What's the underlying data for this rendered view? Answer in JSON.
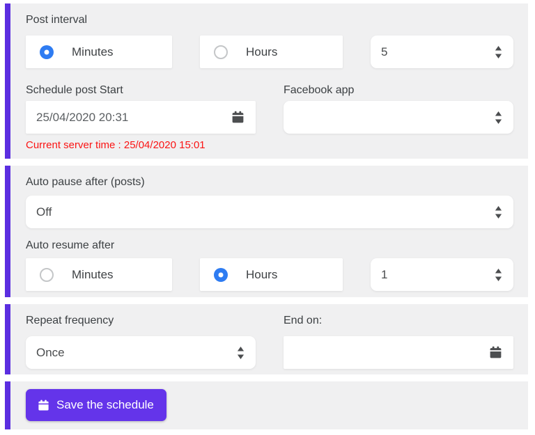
{
  "colors": {
    "accent_purple": "#5b2ee0",
    "button_purple": "#6434ea",
    "radio_selected_blue": "#2e7cf2",
    "section_background": "#f0f0f1",
    "server_time_red": "#fb1414"
  },
  "post_interval": {
    "label": "Post interval",
    "options": [
      {
        "label": "Minutes",
        "selected": true
      },
      {
        "label": "Hours",
        "selected": false
      }
    ],
    "value": "5"
  },
  "schedule_start": {
    "label": "Schedule post Start",
    "value": "25/04/2020 20:31",
    "server_time_note": "Current server time : 25/04/2020 15:01"
  },
  "facebook_app": {
    "label": "Facebook app",
    "value": ""
  },
  "auto_pause": {
    "label": "Auto pause after (posts)",
    "value": "Off"
  },
  "auto_resume": {
    "label": "Auto resume after",
    "options": [
      {
        "label": "Minutes",
        "selected": false
      },
      {
        "label": "Hours",
        "selected": true
      }
    ],
    "value": "1"
  },
  "repeat_frequency": {
    "label": "Repeat frequency",
    "value": "Once"
  },
  "end_on": {
    "label": "End on:",
    "value": ""
  },
  "save_button": {
    "label": "Save the schedule"
  },
  "icons": {
    "spinner": "updown-spinner-icon",
    "calendar": "calendar-icon"
  }
}
